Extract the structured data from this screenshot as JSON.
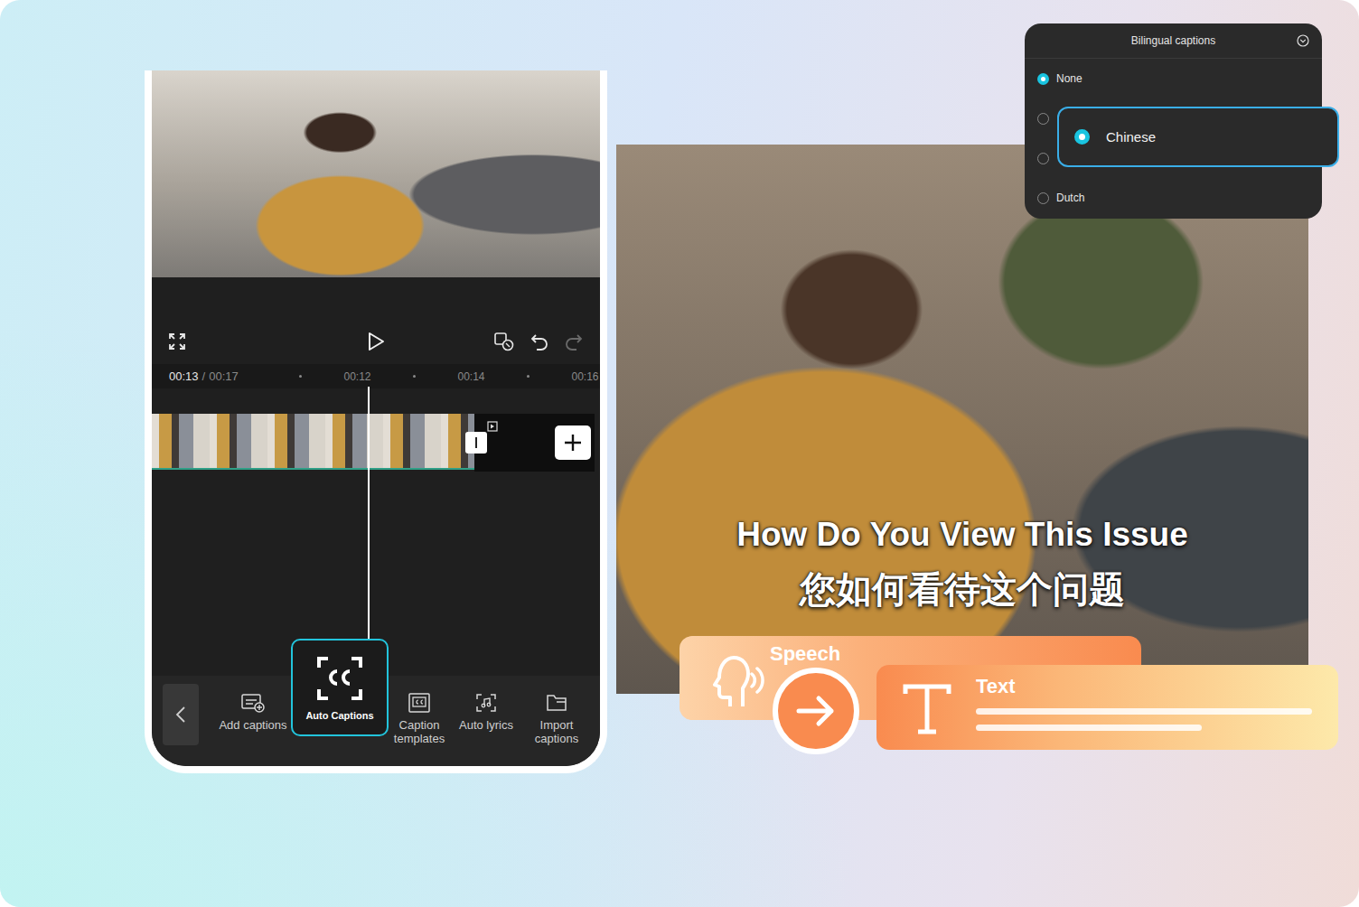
{
  "phone": {
    "time": {
      "current": "00:13",
      "separator": "/",
      "total": "00:17"
    },
    "ruler": [
      "00:12",
      "00:14",
      "00:16"
    ],
    "controls": {
      "undo_disabled": false,
      "redo_disabled": true
    },
    "toolbar": [
      {
        "label": "Add captions",
        "kind": "add",
        "selected": false
      },
      {
        "label": "Auto Captions",
        "kind": "auto",
        "selected": true
      },
      {
        "label": "Caption templates",
        "kind": "template",
        "selected": false
      },
      {
        "label": "Auto lyrics",
        "kind": "lyrics",
        "selected": false
      },
      {
        "label": "Import captions",
        "kind": "import",
        "selected": false
      }
    ]
  },
  "video": {
    "captions": [
      "How Do You View This Issue",
      "您如何看待这个问题"
    ]
  },
  "bilingual_panel": {
    "title": "Bilingual captions",
    "options": [
      {
        "label": "None",
        "kind": "row",
        "selected": true
      },
      {
        "label": "Chinese",
        "kind": "popout",
        "selected": true
      },
      {
        "label": "Dutch",
        "kind": "row",
        "selected": false
      }
    ]
  },
  "flow": {
    "from": "Speech",
    "to": "Text"
  }
}
